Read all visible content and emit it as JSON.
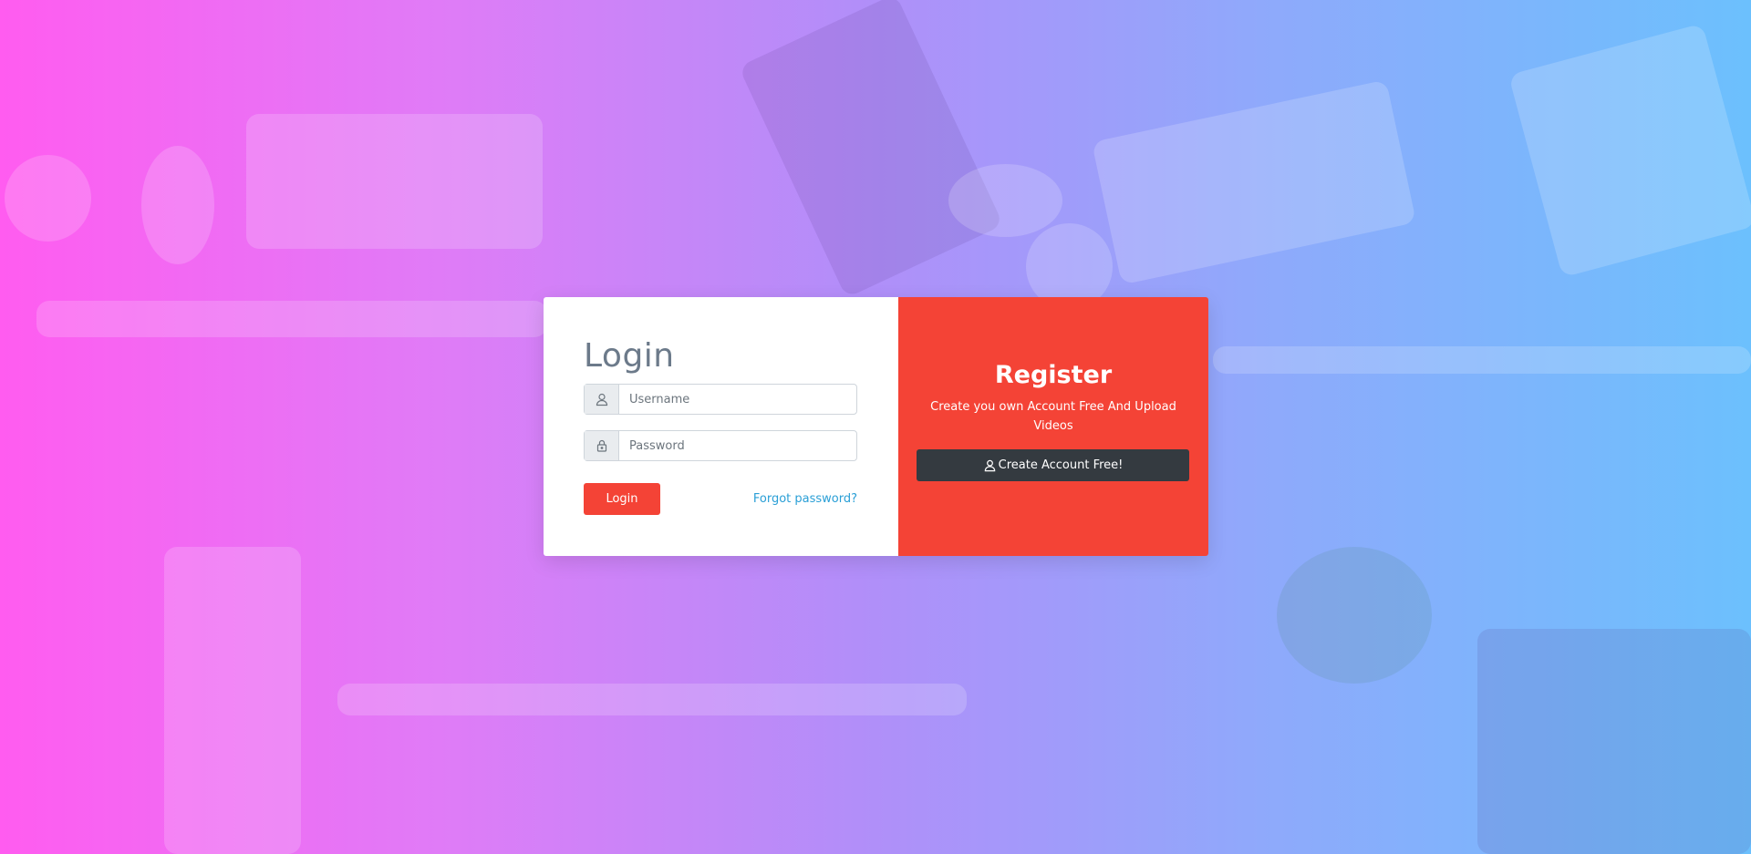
{
  "login": {
    "title": "Login",
    "username_placeholder": "Username",
    "password_placeholder": "Password",
    "username_icon": "user-icon",
    "password_icon": "lock-icon",
    "submit_label": "Login",
    "forgot_label": "Forgot password?"
  },
  "register": {
    "title": "Register",
    "subtitle": "Create you own Account Free And Upload Videos",
    "button_icon": "user-icon",
    "button_label": "Create Account Free!"
  },
  "colors": {
    "accent": "#f44336",
    "dark_button": "#343a40",
    "link": "#2a9fd6",
    "title": "#6c7a8a"
  }
}
